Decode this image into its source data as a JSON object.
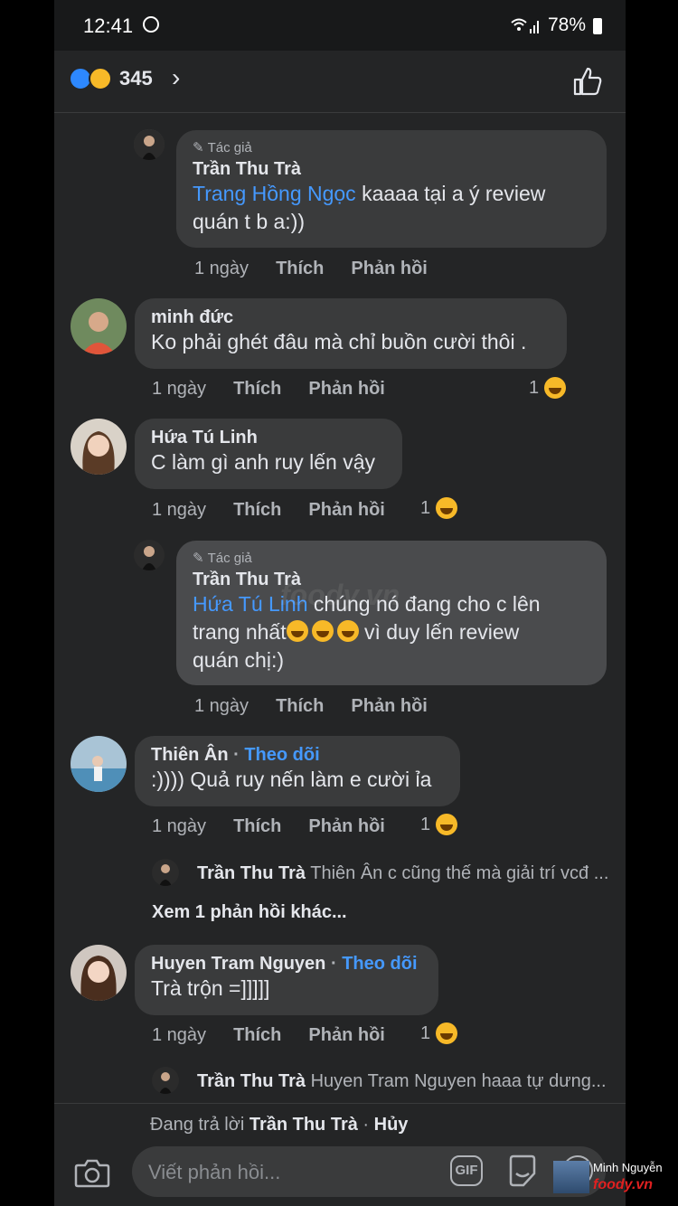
{
  "status_bar": {
    "time": "12:41",
    "battery": "78%"
  },
  "header": {
    "reaction_count": "345"
  },
  "comments": [
    {
      "author_tag": "Tác giả",
      "name": "Trần Thu Trà",
      "mention": "Trang Hồng Ngọc",
      "text_line1": " kaaaa tại a ý review",
      "text_line2": "quán t b a:))",
      "time": "1 ngày",
      "like": "Thích",
      "reply": "Phản hồi"
    },
    {
      "name": "minh đức",
      "text": "Ko phải ghét đâu mà chỉ buồn cười thôi .",
      "time": "1 ngày",
      "like": "Thích",
      "reply": "Phản hồi",
      "reactions": "1"
    },
    {
      "name": "Hứa Tú Linh",
      "text": "C làm gì anh ruy lến vậy",
      "time": "1 ngày",
      "like": "Thích",
      "reply": "Phản hồi",
      "reactions": "1"
    },
    {
      "author_tag": "Tác giả",
      "name": "Trần Thu Trà",
      "mention": "Hứa Tú Linh",
      "text_line1": " chúng nó đang cho c lên",
      "text_line2a": "trang nhất",
      "text_line2b": " vì duy lến review",
      "text_line3": "quán chị:)",
      "time": "1 ngày",
      "like": "Thích",
      "reply": "Phản hồi"
    },
    {
      "name": "Thiên Ân",
      "follow": "Theo dõi",
      "text": ":)))) Quả ruy nến làm e cười ỉa",
      "time": "1 ngày",
      "like": "Thích",
      "reply": "Phản hồi",
      "reactions": "1"
    },
    {
      "name": "Huyen Tram Nguyen",
      "follow": "Theo dõi",
      "text": "Trà trộn =]]]]]",
      "time": "1 ngày",
      "like": "Thích",
      "reply": "Phản hồi",
      "reactions": "1"
    }
  ],
  "reply_previews": [
    {
      "name": "Trần Thu Trà",
      "text": " Thiên Ân c cũng thế mà giải trí vcđ ..."
    },
    {
      "name": "Trần Thu Trà",
      "text": " Huyen Tram Nguyen haaa tự dưng..."
    }
  ],
  "more_replies": "Xem 1 phản hồi khác...",
  "replying_bar": {
    "prefix": "Đang trả lời ",
    "name": "Trần Thu Trà",
    "sep": " · ",
    "cancel": "Hủy"
  },
  "composer": {
    "placeholder": "Viết phản hồi...",
    "gif": "GIF"
  },
  "watermark": {
    "name": "Minh Nguyễn",
    "logo": "foody.vn"
  },
  "center_watermark": "foody.vn",
  "colors": {
    "background": "#242526",
    "bubble": "#3a3b3c",
    "link": "#4599ff",
    "like_blue": "#2d88ff",
    "haha_yellow": "#f7b928"
  }
}
